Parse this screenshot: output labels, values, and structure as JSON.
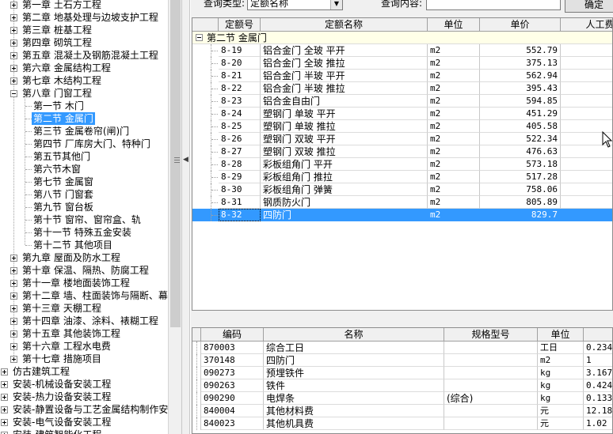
{
  "tree": {
    "items": [
      {
        "label": "第一章 土石方工程",
        "level": 1,
        "expandable": true,
        "expanded": false
      },
      {
        "label": "第二章 地基处理与边坡支护工程",
        "level": 1,
        "expandable": true,
        "expanded": false
      },
      {
        "label": "第三章 桩基工程",
        "level": 1,
        "expandable": true,
        "expanded": false
      },
      {
        "label": "第四章 砌筑工程",
        "level": 1,
        "expandable": true,
        "expanded": false
      },
      {
        "label": "第五章 混凝土及钢筋混凝土工程",
        "level": 1,
        "expandable": true,
        "expanded": false
      },
      {
        "label": "第六章 金属结构工程",
        "level": 1,
        "expandable": true,
        "expanded": false
      },
      {
        "label": "第七章 木结构工程",
        "level": 1,
        "expandable": true,
        "expanded": false
      },
      {
        "label": "第八章 门窗工程",
        "level": 1,
        "expandable": true,
        "expanded": true
      },
      {
        "label": "第一节 木门",
        "level": 2,
        "expandable": false
      },
      {
        "label": "第二节 金属门",
        "level": 2,
        "expandable": false,
        "selected": true
      },
      {
        "label": "第三节 金属卷帘(闸)门",
        "level": 2,
        "expandable": false
      },
      {
        "label": "第四节 厂库房大门、特种门",
        "level": 2,
        "expandable": false
      },
      {
        "label": "第五节其他门",
        "level": 2,
        "expandable": false
      },
      {
        "label": "第六节木窗",
        "level": 2,
        "expandable": false
      },
      {
        "label": "第七节 金属窗",
        "level": 2,
        "expandable": false
      },
      {
        "label": "第八节 门窗套",
        "level": 2,
        "expandable": false
      },
      {
        "label": "第九节 窗台板",
        "level": 2,
        "expandable": false
      },
      {
        "label": "第十节 窗帘、窗帘盒、轨",
        "level": 2,
        "expandable": false
      },
      {
        "label": "第十一节 特殊五金安装",
        "level": 2,
        "expandable": false
      },
      {
        "label": "第十二节 其他项目",
        "level": 2,
        "expandable": false
      },
      {
        "label": "第九章 屋面及防水工程",
        "level": 1,
        "expandable": true,
        "expanded": false
      },
      {
        "label": "第十章 保温、隔热、防腐工程",
        "level": 1,
        "expandable": true,
        "expanded": false
      },
      {
        "label": "第十一章 楼地面装饰工程",
        "level": 1,
        "expandable": true,
        "expanded": false
      },
      {
        "label": "第十二章 墙、柱面装饰与隔断、幕",
        "level": 1,
        "expandable": true,
        "expanded": false
      },
      {
        "label": "第十三章 天棚工程",
        "level": 1,
        "expandable": true,
        "expanded": false
      },
      {
        "label": "第十四章 油漆、涂料、裱糊工程",
        "level": 1,
        "expandable": true,
        "expanded": false
      },
      {
        "label": "第十五章 其他装饰工程",
        "level": 1,
        "expandable": true,
        "expanded": false
      },
      {
        "label": "第十六章 工程水电费",
        "level": 1,
        "expandable": true,
        "expanded": false
      },
      {
        "label": "第十七章 措施项目",
        "level": 1,
        "expandable": true,
        "expanded": false
      },
      {
        "label": "仿古建筑工程",
        "level": 0,
        "expandable": true,
        "expanded": false
      },
      {
        "label": "安装-机械设备安装工程",
        "level": 0,
        "expandable": true,
        "expanded": false
      },
      {
        "label": "安装-热力设备安装工程",
        "level": 0,
        "expandable": true,
        "expanded": false
      },
      {
        "label": "安装-静置设备与工艺金属结构制作安",
        "level": 0,
        "expandable": true,
        "expanded": false
      },
      {
        "label": "安装-电气设备安装工程",
        "level": 0,
        "expandable": true,
        "expanded": false
      },
      {
        "label": "安装-建筑智能化工程",
        "level": 0,
        "expandable": true,
        "expanded": false
      }
    ]
  },
  "query": {
    "type_label": "查询类型:",
    "type_value": "定额名称",
    "content_label": "查询内容:",
    "content_value": "",
    "confirm_label": "确定"
  },
  "quota_grid": {
    "columns": [
      "定额号",
      "定额名称",
      "单位",
      "单价",
      "人工费"
    ],
    "group_label": "第二节 金属门",
    "rows": [
      {
        "code": "8-19",
        "name": "铝合金门 全玻 平开",
        "unit": "m2",
        "price": "552.79"
      },
      {
        "code": "8-20",
        "name": "铝合金门 全玻 推拉",
        "unit": "m2",
        "price": "375.13"
      },
      {
        "code": "8-21",
        "name": "铝合金门 半玻 平开",
        "unit": "m2",
        "price": "562.94"
      },
      {
        "code": "8-22",
        "name": "铝合金门 半玻 推拉",
        "unit": "m2",
        "price": "395.43"
      },
      {
        "code": "8-23",
        "name": "铝合金自由门",
        "unit": "m2",
        "price": "594.85"
      },
      {
        "code": "8-24",
        "name": "塑钢门 单玻 平开",
        "unit": "m2",
        "price": "451.29"
      },
      {
        "code": "8-25",
        "name": "塑钢门 单玻 推拉",
        "unit": "m2",
        "price": "405.58"
      },
      {
        "code": "8-26",
        "name": "塑钢门 双玻 平开",
        "unit": "m2",
        "price": "522.34"
      },
      {
        "code": "8-27",
        "name": "塑钢门 双玻 推拉",
        "unit": "m2",
        "price": "476.63"
      },
      {
        "code": "8-28",
        "name": "彩板组角门 平开",
        "unit": "m2",
        "price": "573.18"
      },
      {
        "code": "8-29",
        "name": "彩板组角门 推拉",
        "unit": "m2",
        "price": "517.28"
      },
      {
        "code": "8-30",
        "name": "彩板组角门 弹簧",
        "unit": "m2",
        "price": "758.06"
      },
      {
        "code": "8-31",
        "name": "钢质防火门",
        "unit": "m2",
        "price": "805.89"
      },
      {
        "code": "8-32",
        "name": "四防门",
        "unit": "m2",
        "price": "829.7",
        "selected": true
      }
    ]
  },
  "material_grid": {
    "columns": [
      "编码",
      "名称",
      "规格型号",
      "单位",
      ""
    ],
    "rows": [
      {
        "code": "870003",
        "name": "综合工日",
        "spec": "",
        "unit": "工日",
        "qty": "0.234"
      },
      {
        "code": "370148",
        "name": "四防门",
        "spec": "",
        "unit": "m2",
        "qty": "1"
      },
      {
        "code": "090273",
        "name": "预埋铁件",
        "spec": "",
        "unit": "kg",
        "qty": "3.167"
      },
      {
        "code": "090263",
        "name": "铁件",
        "spec": "",
        "unit": "kg",
        "qty": "0.424"
      },
      {
        "code": "090290",
        "name": "电焊条",
        "spec": "(综合)",
        "unit": "kg",
        "qty": "0.133"
      },
      {
        "code": "840004",
        "name": "其他材料费",
        "spec": "",
        "unit": "元",
        "qty": "12.18"
      },
      {
        "code": "840023",
        "name": "其他机具费",
        "spec": "",
        "unit": "元",
        "qty": "1.02"
      }
    ]
  }
}
